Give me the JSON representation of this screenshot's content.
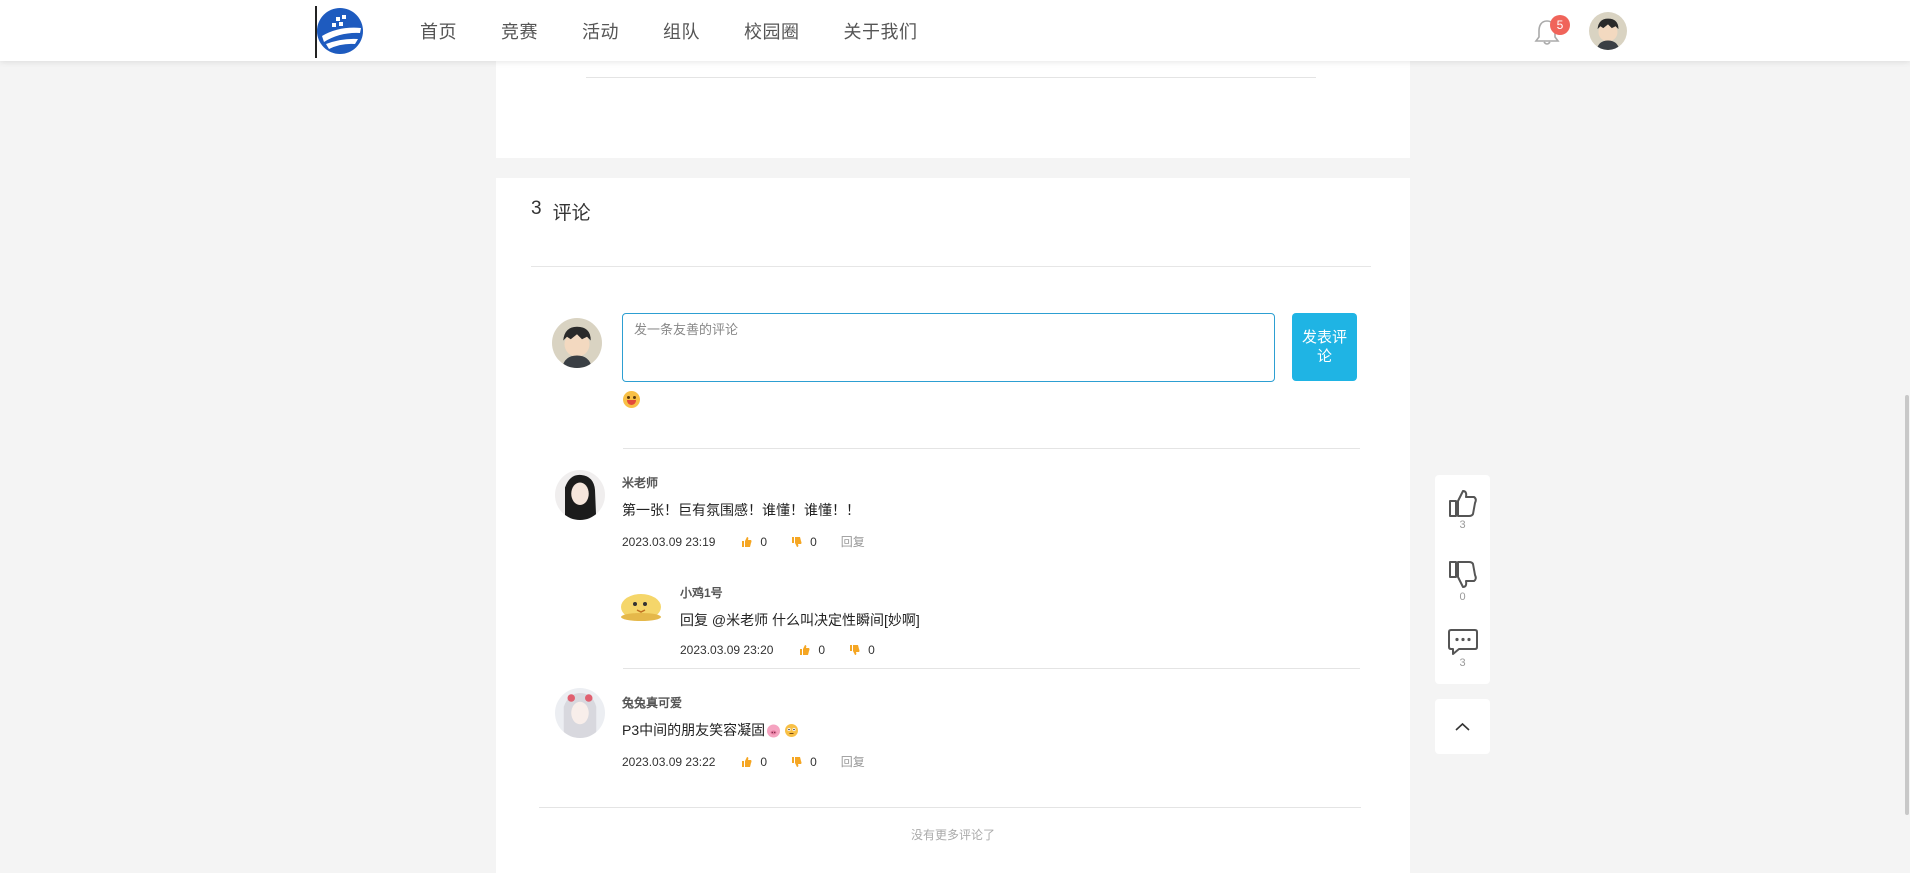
{
  "header": {
    "nav": [
      "首页",
      "竞赛",
      "活动",
      "组队",
      "校园圈",
      "关于我们"
    ],
    "notification_count": "5",
    "accent": "#1fb4e4",
    "badge_color": "#f0645a"
  },
  "comments_section": {
    "count": "3",
    "label": "评论",
    "input_placeholder": "发一条友善的评论",
    "submit_label": "发表评论",
    "no_more": "没有更多评论了"
  },
  "comments": [
    {
      "user": "米老师",
      "text": "第一张！巨有氛围感！谁懂！谁懂！！",
      "time": "2023.03.09 23:19",
      "likes": "0",
      "dislikes": "0",
      "reply_label": "回复"
    },
    {
      "user": "小鸡1号",
      "text": "回复 @米老师 什么叫决定性瞬间[妙啊]",
      "time": "2023.03.09 23:20",
      "likes": "0",
      "dislikes": "0"
    },
    {
      "user": "兔兔真可爱",
      "text": "P3中间的朋友笑容凝固",
      "time": "2023.03.09 23:22",
      "likes": "0",
      "dislikes": "0",
      "reply_label": "回复"
    }
  ],
  "side_actions": {
    "like_count": "3",
    "dislike_count": "0",
    "comment_count": "3"
  }
}
